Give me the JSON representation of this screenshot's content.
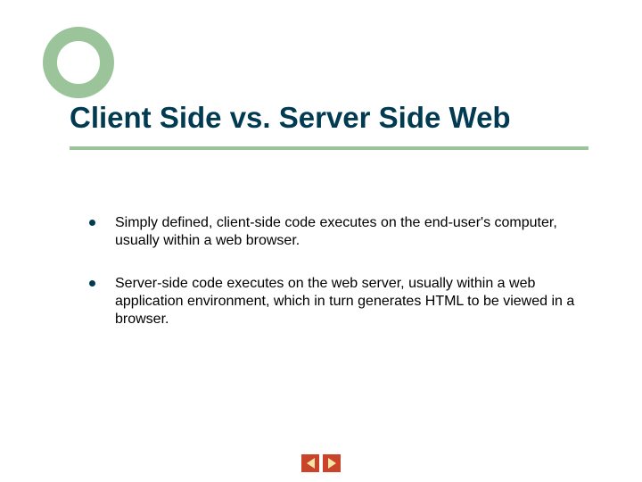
{
  "colors": {
    "title": "#003b52",
    "accent": "#9bc49b",
    "nav_bg": "#c9442a",
    "nav_arrow": "#f5e6a8"
  },
  "title": "Client Side vs. Server Side Web",
  "bullets": [
    "Simply defined, client-side code executes on the end-user's computer, usually within a web browser.",
    "Server-side code executes on the web server, usually within a web application environment, which in turn generates HTML to be viewed in a browser."
  ]
}
